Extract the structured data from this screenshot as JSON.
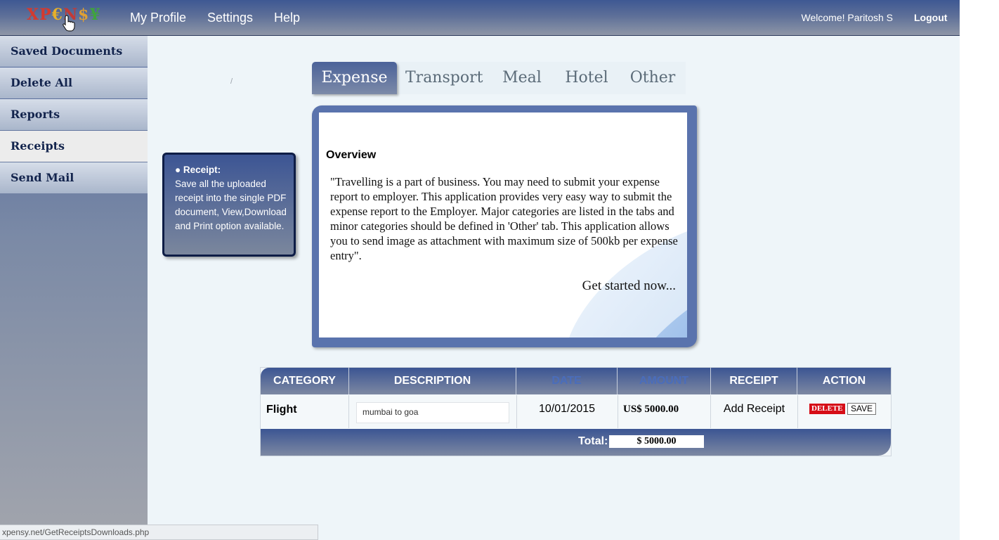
{
  "header": {
    "logo": {
      "x": "X",
      "e": "€",
      "n": "N",
      "s": "$",
      "y": "¥",
      "p1": "P",
      "y2": "Y"
    },
    "nav": [
      "My Profile",
      "Settings",
      "Help"
    ],
    "welcome": "Welcome! Paritosh S",
    "logout": "Logout"
  },
  "sidebar": {
    "items": [
      {
        "label": "Saved Documents"
      },
      {
        "label": "Delete All"
      },
      {
        "label": "Reports"
      },
      {
        "label": "Receipts",
        "active": true
      },
      {
        "label": "Send Mail"
      }
    ]
  },
  "tooltip": {
    "title": "● Receipt:",
    "body": "Save all the uploaded receipt into the single PDF document, View,Download and Print option available."
  },
  "slash": "/",
  "tabs": [
    "Expense",
    "Transport",
    "Meal",
    "Hotel",
    "Other"
  ],
  "overview": {
    "title": "Overview",
    "text": "\"Travelling is a part of business. You may need to submit your expense report to employer. This application provides very easy way to submit the expense report to the Employer. Major categories are listed in the tabs and minor categories should be defined in 'Other' tab. This application allows you to send image as attachment with maximum size of 500kb per expense entry\".",
    "cta": "Get started now..."
  },
  "table": {
    "headers": [
      "CATEGORY",
      "DESCRIPTION",
      "DATE",
      "AMOUNT",
      "RECEIPT",
      "ACTION"
    ],
    "row": {
      "category": "Flight",
      "description": "mumbai to goa",
      "date": "10/01/2015",
      "amount": "US$  5000.00",
      "receipt": "Add Receipt",
      "delete": "DELETE",
      "save": "SAVE"
    },
    "total_label": "Total:",
    "total_value": "$ 5000.00"
  },
  "status_url": "xpensy.net/GetReceiptsDownloads.php"
}
